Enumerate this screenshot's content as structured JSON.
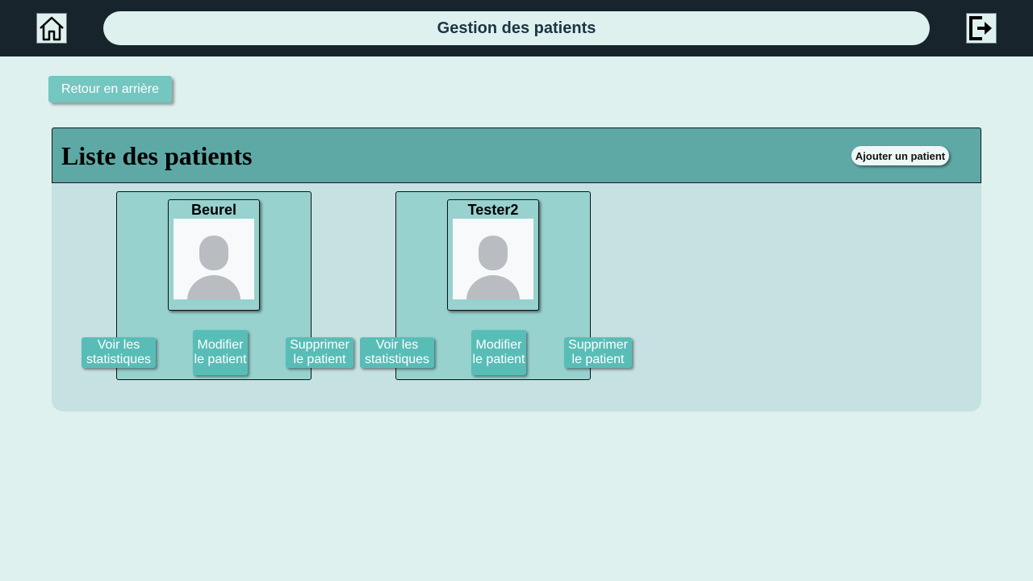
{
  "header": {
    "title": "Gestion des patients",
    "home_icon": "home-icon",
    "logout_icon": "logout-icon"
  },
  "back_button": "Retour en arrière",
  "panel": {
    "title": "Liste des patients",
    "add_button": "Ajouter un patient"
  },
  "patients": [
    {
      "name": "Beurel",
      "avatar_icon": "user-placeholder-icon",
      "stats_button": "Voir les statistiques",
      "edit_button": "Modifier le patient",
      "delete_button": "Supprimer le patient"
    },
    {
      "name": "Tester2",
      "avatar_icon": "user-placeholder-icon",
      "stats_button": "Voir les statistiques",
      "edit_button": "Modifier le patient",
      "delete_button": "Supprimer le patient"
    }
  ],
  "colors": {
    "topbar": "#17242b",
    "background": "#dff1ef",
    "panel_header": "#5ea9a6",
    "card": "#97d2cf",
    "button": "#59bdb7"
  }
}
